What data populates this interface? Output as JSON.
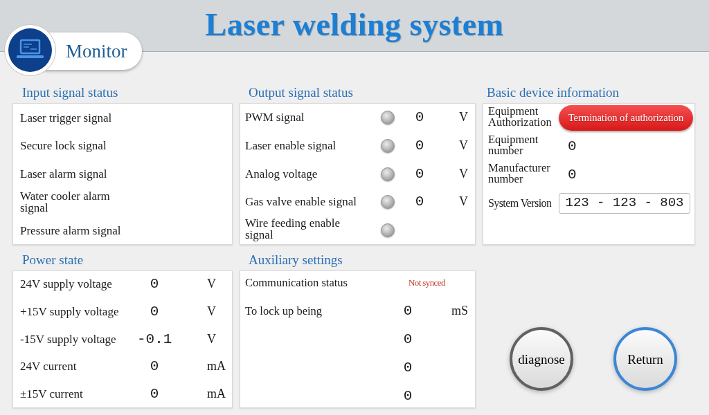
{
  "header": {
    "title": "Laser welding system",
    "page_badge": "Monitor"
  },
  "input_signal_status": {
    "heading": "Input signal status",
    "signals": [
      "Laser trigger signal",
      "Secure lock signal",
      "Laser alarm signal",
      "Water cooler alarm signal",
      "Pressure alarm signal"
    ]
  },
  "output_signal_status": {
    "heading": "Output signal status",
    "signals": [
      {
        "label": "PWM signal",
        "on": false,
        "value": "0",
        "unit": "V"
      },
      {
        "label": "Laser enable signal",
        "on": false,
        "value": "0",
        "unit": "V"
      },
      {
        "label": "Analog voltage",
        "on": false,
        "value": "0",
        "unit": "V"
      },
      {
        "label": "Gas valve enable signal",
        "on": false,
        "value": "0",
        "unit": "V"
      },
      {
        "label": "Wire feeding enable signal",
        "on": false
      }
    ]
  },
  "basic_device_information": {
    "heading": "Basic device information",
    "rows": [
      {
        "kind": "button",
        "label": "Equipment Authorization",
        "button": "Termination of authorization"
      },
      {
        "kind": "value",
        "label": "Equipment number",
        "value": "0"
      },
      {
        "kind": "value",
        "label": "Manufacturer number",
        "value": "0"
      },
      {
        "kind": "field",
        "label": "System Version",
        "value": "123 - 123 - 803"
      }
    ]
  },
  "power_state": {
    "heading": "Power state",
    "rows": [
      {
        "label": "24V supply voltage",
        "value": "0",
        "unit": "V"
      },
      {
        "label": "+15V supply voltage",
        "value": "0",
        "unit": "V"
      },
      {
        "label": "-15V supply voltage",
        "value": "-0.1",
        "unit": "V"
      },
      {
        "label": "24V current",
        "value": "0",
        "unit": "mA"
      },
      {
        "label": "±15V current",
        "value": "0",
        "unit": "mA"
      }
    ]
  },
  "auxiliary_settings": {
    "heading": "Auxiliary settings",
    "rows": [
      {
        "kind": "status",
        "label": "Communication status",
        "value": "Not synced"
      },
      {
        "kind": "value",
        "label": "To lock up being",
        "value": "0",
        "unit": "mS"
      },
      {
        "kind": "value",
        "value": "0"
      },
      {
        "kind": "value",
        "value": "0"
      },
      {
        "kind": "value",
        "value": "0"
      }
    ]
  },
  "buttons": [
    {
      "label": "diagnose",
      "color": "#616161"
    },
    {
      "label": "Return",
      "color": "#3b86d6"
    }
  ]
}
